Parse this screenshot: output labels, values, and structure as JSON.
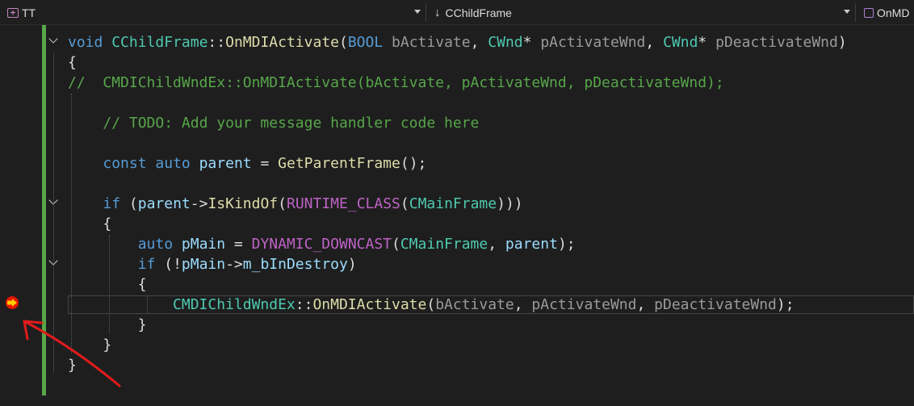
{
  "navbar": {
    "project": "TT",
    "class": "CChildFrame",
    "member": "OnMD"
  },
  "code": {
    "lines": [
      {
        "segments": [
          [
            "kw",
            "void"
          ],
          [
            "pn",
            " "
          ],
          [
            "ty",
            "CChildFrame"
          ],
          [
            "pn",
            "::"
          ],
          [
            "fn",
            "OnMDIActivate"
          ],
          [
            "pn",
            "("
          ],
          [
            "kw",
            "BOOL"
          ],
          [
            "pn",
            " "
          ],
          [
            "pr",
            "bActivate"
          ],
          [
            "pn",
            ", "
          ],
          [
            "ty",
            "CWnd"
          ],
          [
            "pn",
            "* "
          ],
          [
            "pr",
            "pActivateWnd"
          ],
          [
            "pn",
            ", "
          ],
          [
            "ty",
            "CWnd"
          ],
          [
            "pn",
            "* "
          ],
          [
            "pr",
            "pDeactivateWnd"
          ],
          [
            "pn",
            ")"
          ]
        ]
      },
      {
        "segments": [
          [
            "pn",
            "{"
          ]
        ]
      },
      {
        "segments": [
          [
            "cm",
            "//  CMDIChildWndEx::OnMDIActivate(bActivate, pActivateWnd, pDeactivateWnd);"
          ]
        ]
      },
      {
        "segments": []
      },
      {
        "segments": [
          [
            "pn",
            "    "
          ],
          [
            "cm",
            "// TODO: Add your message handler code here"
          ]
        ]
      },
      {
        "segments": []
      },
      {
        "segments": [
          [
            "pn",
            "    "
          ],
          [
            "kw",
            "const"
          ],
          [
            "pn",
            " "
          ],
          [
            "kw",
            "auto"
          ],
          [
            "pn",
            " "
          ],
          [
            "va",
            "parent"
          ],
          [
            "pn",
            " = "
          ],
          [
            "fn",
            "GetParentFrame"
          ],
          [
            "pn",
            "();"
          ]
        ]
      },
      {
        "segments": []
      },
      {
        "segments": [
          [
            "pn",
            "    "
          ],
          [
            "kw",
            "if"
          ],
          [
            "pn",
            " ("
          ],
          [
            "va",
            "parent"
          ],
          [
            "pn",
            "->"
          ],
          [
            "fn",
            "IsKindOf"
          ],
          [
            "pn",
            "("
          ],
          [
            "mc",
            "RUNTIME_CLASS"
          ],
          [
            "pn",
            "("
          ],
          [
            "ty",
            "CMainFrame"
          ],
          [
            "pn",
            ")))"
          ]
        ]
      },
      {
        "segments": [
          [
            "pn",
            "    {"
          ]
        ]
      },
      {
        "segments": [
          [
            "pn",
            "        "
          ],
          [
            "kw",
            "auto"
          ],
          [
            "pn",
            " "
          ],
          [
            "va",
            "pMain"
          ],
          [
            "pn",
            " = "
          ],
          [
            "mc",
            "DYNAMIC_DOWNCAST"
          ],
          [
            "pn",
            "("
          ],
          [
            "ty",
            "CMainFrame"
          ],
          [
            "pn",
            ", "
          ],
          [
            "va",
            "parent"
          ],
          [
            "pn",
            ");"
          ]
        ]
      },
      {
        "segments": [
          [
            "pn",
            "        "
          ],
          [
            "kw",
            "if"
          ],
          [
            "pn",
            " (!"
          ],
          [
            "va",
            "pMain"
          ],
          [
            "pn",
            "->"
          ],
          [
            "va",
            "m_bInDestroy"
          ],
          [
            "pn",
            ")"
          ]
        ]
      },
      {
        "segments": [
          [
            "pn",
            "        {"
          ]
        ]
      },
      {
        "segments": [
          [
            "pn",
            "            "
          ],
          [
            "ty",
            "CMDIChildWndEx"
          ],
          [
            "pn",
            "::"
          ],
          [
            "fn",
            "OnMDIActivate"
          ],
          [
            "pn",
            "("
          ],
          [
            "pr",
            "bActivate"
          ],
          [
            "pn",
            ", "
          ],
          [
            "pr",
            "pActivateWnd"
          ],
          [
            "pn",
            ", "
          ],
          [
            "pr",
            "pDeactivateWnd"
          ],
          [
            "pn",
            ");"
          ]
        ]
      },
      {
        "segments": [
          [
            "pn",
            "        }"
          ]
        ]
      },
      {
        "segments": [
          [
            "pn",
            "    }"
          ]
        ]
      },
      {
        "segments": [
          [
            "pn",
            "}"
          ]
        ]
      }
    ]
  },
  "colors": {
    "background": "#1e1e1e",
    "change_bar": "#57a64a",
    "breakpoint": "#e51400",
    "execution_arrow": "#ffcc00",
    "annotation_arrow": "#e01b1b"
  }
}
